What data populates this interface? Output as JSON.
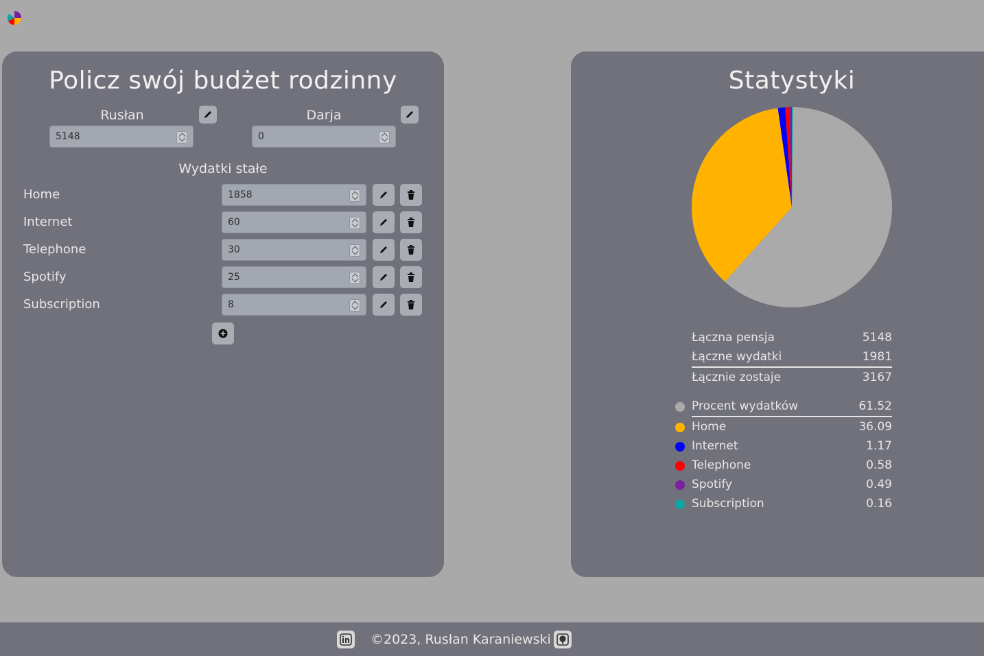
{
  "header": {
    "logo_icon": "pie-chart-icon"
  },
  "budget": {
    "title": "Policz swój budżet rodzinny",
    "people": [
      {
        "name": "Rusłan",
        "income": "5148"
      },
      {
        "name": "Darja",
        "income": "0"
      }
    ],
    "expenses_title": "Wydatki stałe",
    "expenses": [
      {
        "name": "Home",
        "amount": "1858"
      },
      {
        "name": "Internet",
        "amount": "60"
      },
      {
        "name": "Telephone",
        "amount": "30"
      },
      {
        "name": "Spotify",
        "amount": "25"
      },
      {
        "name": "Subscription",
        "amount": "8"
      }
    ],
    "icons": {
      "edit": "pencil-icon",
      "delete": "trash-icon",
      "add": "plus-circle-icon"
    }
  },
  "stats": {
    "title": "Statystyki",
    "summary": [
      {
        "label": "Łączna pensja",
        "value": "5148"
      },
      {
        "label": "Łączne wydatki",
        "value": "1981"
      },
      {
        "label": "Łącznie zostaje",
        "value": "3167"
      }
    ],
    "legend": [
      {
        "label": "Procent wydatków",
        "value": "61.52",
        "color": "#aaaaaa"
      },
      {
        "label": "Home",
        "value": "36.09",
        "color": "#ffb300"
      },
      {
        "label": "Internet",
        "value": "1.17",
        "color": "#0000ff"
      },
      {
        "label": "Telephone",
        "value": "0.58",
        "color": "#ff0000"
      },
      {
        "label": "Spotify",
        "value": "0.49",
        "color": "#7a1fa2"
      },
      {
        "label": "Subscription",
        "value": "0.16",
        "color": "#11a5a5"
      }
    ]
  },
  "chart_data": {
    "type": "pie",
    "categories": [
      "Procent wydatków",
      "Home",
      "Internet",
      "Telephone",
      "Spotify",
      "Subscription"
    ],
    "values": [
      61.52,
      36.09,
      1.17,
      0.58,
      0.49,
      0.16
    ],
    "colors": [
      "#aaaaaa",
      "#ffb300",
      "#0000ff",
      "#ff0000",
      "#7a1fa2",
      "#11a5a5"
    ]
  },
  "footer": {
    "text": "©2023, Rusłan Karaniewski",
    "linkedin_icon": "linkedin-icon",
    "github_icon": "github-icon"
  }
}
